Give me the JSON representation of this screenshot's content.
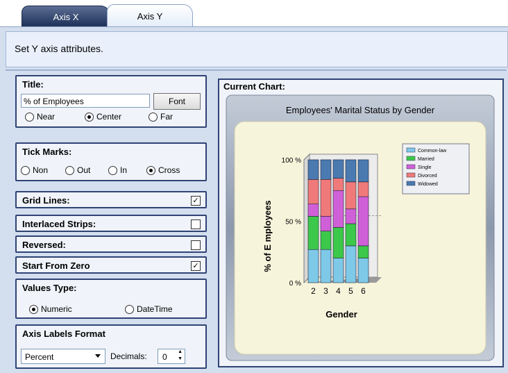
{
  "tabs": [
    {
      "label": "Axis X",
      "active": false
    },
    {
      "label": "Axis Y",
      "active": true
    }
  ],
  "header": {
    "text": "Set Y axis attributes."
  },
  "title_group": {
    "label": "Title:",
    "value": "% of Employees",
    "font_button": "Font",
    "alignment": [
      "Near",
      "Center",
      "Far"
    ],
    "selected": "Center"
  },
  "tick_marks": {
    "label": "Tick Marks:",
    "options": [
      "Non",
      "Out",
      "In",
      "Cross"
    ],
    "selected": "Cross"
  },
  "grid_lines": {
    "label": "Grid Lines:",
    "checked": true
  },
  "interlaced": {
    "label": "Interlaced Strips:",
    "checked": false
  },
  "reversed": {
    "label": "Reversed:",
    "checked": false
  },
  "start_zero": {
    "label": "Start From Zero",
    "checked": true
  },
  "values_type": {
    "label": "Values Type:",
    "options": [
      "Numeric",
      "DateTime"
    ],
    "selected": "Numeric"
  },
  "labels_format": {
    "label": "Axis Labels Format",
    "format": "Percent",
    "decimals_label": "Decimals:",
    "decimals": "0"
  },
  "chart_group": {
    "label": "Current Chart:"
  },
  "chart_data": {
    "type": "bar",
    "title": "Employees' Marital Status by Gender",
    "xlabel": "Gender",
    "ylabel": "% of E mployees",
    "categories": [
      "2",
      "3",
      "4",
      "5",
      "6"
    ],
    "yticks": [
      "100 %",
      "50 %",
      "0 %"
    ],
    "ylim": [
      0,
      100
    ],
    "stacked_percent": true,
    "series": [
      {
        "name": "Common-law",
        "color": "#7ec8e8",
        "values": [
          27,
          27,
          20,
          30,
          20
        ]
      },
      {
        "name": "Married",
        "color": "#3cc84a",
        "values": [
          27,
          15,
          25,
          18,
          10
        ]
      },
      {
        "name": "Single",
        "color": "#d060d8",
        "values": [
          10,
          12,
          30,
          12,
          40
        ]
      },
      {
        "name": "Divorced",
        "color": "#f07a7a",
        "values": [
          20,
          30,
          10,
          22,
          12
        ]
      },
      {
        "name": "Widowed",
        "color": "#4a7ab0",
        "values": [
          16,
          16,
          15,
          18,
          18
        ]
      }
    ]
  },
  "checkmark_glyph": "✓",
  "spinner": {
    "up": "▲",
    "down": "▼"
  }
}
